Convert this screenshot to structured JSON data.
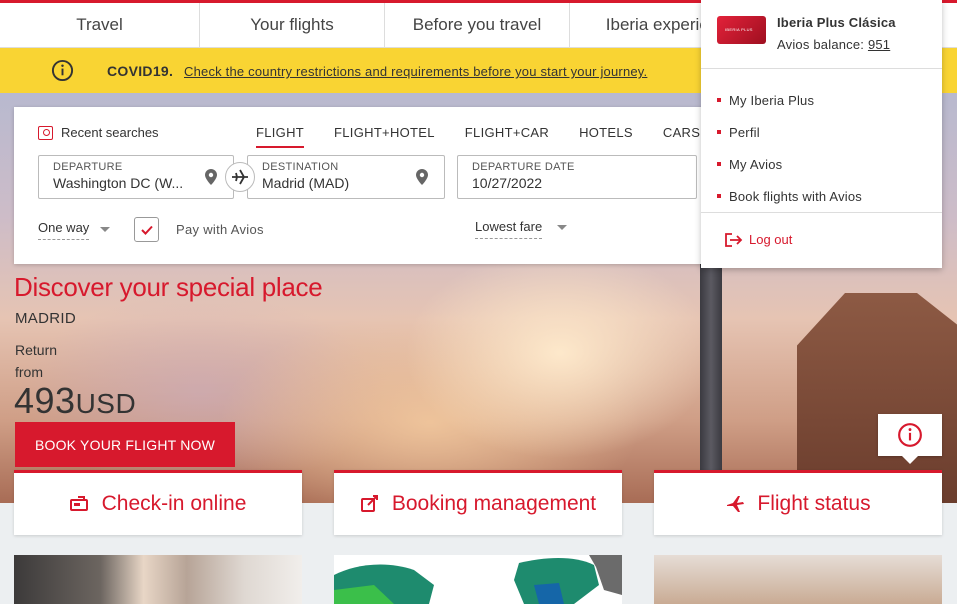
{
  "nav": {
    "items": [
      "Travel",
      "Your flights",
      "Before you travel",
      "Iberia experien"
    ]
  },
  "covid": {
    "title": "COVID19.",
    "link": "Check the country restrictions and requirements before you start your journey."
  },
  "search": {
    "recent_label": "Recent searches",
    "tabs": [
      "FLIGHT",
      "FLIGHT+HOTEL",
      "FLIGHT+CAR",
      "HOTELS",
      "CARS"
    ],
    "departure": {
      "label": "DEPARTURE",
      "value": "Washington DC (W..."
    },
    "destination": {
      "label": "DESTINATION",
      "value": "Madrid (MAD)"
    },
    "date": {
      "label": "DEPARTURE DATE",
      "value": "10/27/2022"
    },
    "trip_type": "One way",
    "pay_with_avios": "Pay with Avios",
    "fare": "Lowest fare"
  },
  "promo": {
    "title": "Discover your special place",
    "city": "MADRID",
    "return_label": "Return",
    "from_label": "from",
    "price": "493",
    "currency": "USD",
    "cta": "BOOK YOUR FLIGHT NOW"
  },
  "cards": {
    "checkin": "Check-in online",
    "booking": "Booking management",
    "status": "Flight status"
  },
  "account": {
    "card_text": "IBERIA PLUS",
    "name": "Iberia Plus Clásica",
    "balance_label": "Avios balance:",
    "balance_value": "951",
    "menu": [
      "My Iberia Plus",
      "Perfil",
      "My Avios",
      "Book flights with Avios"
    ],
    "logout": "Log out"
  },
  "colors": {
    "brand_red": "#d7192d",
    "banner_yellow": "#f9d433"
  }
}
